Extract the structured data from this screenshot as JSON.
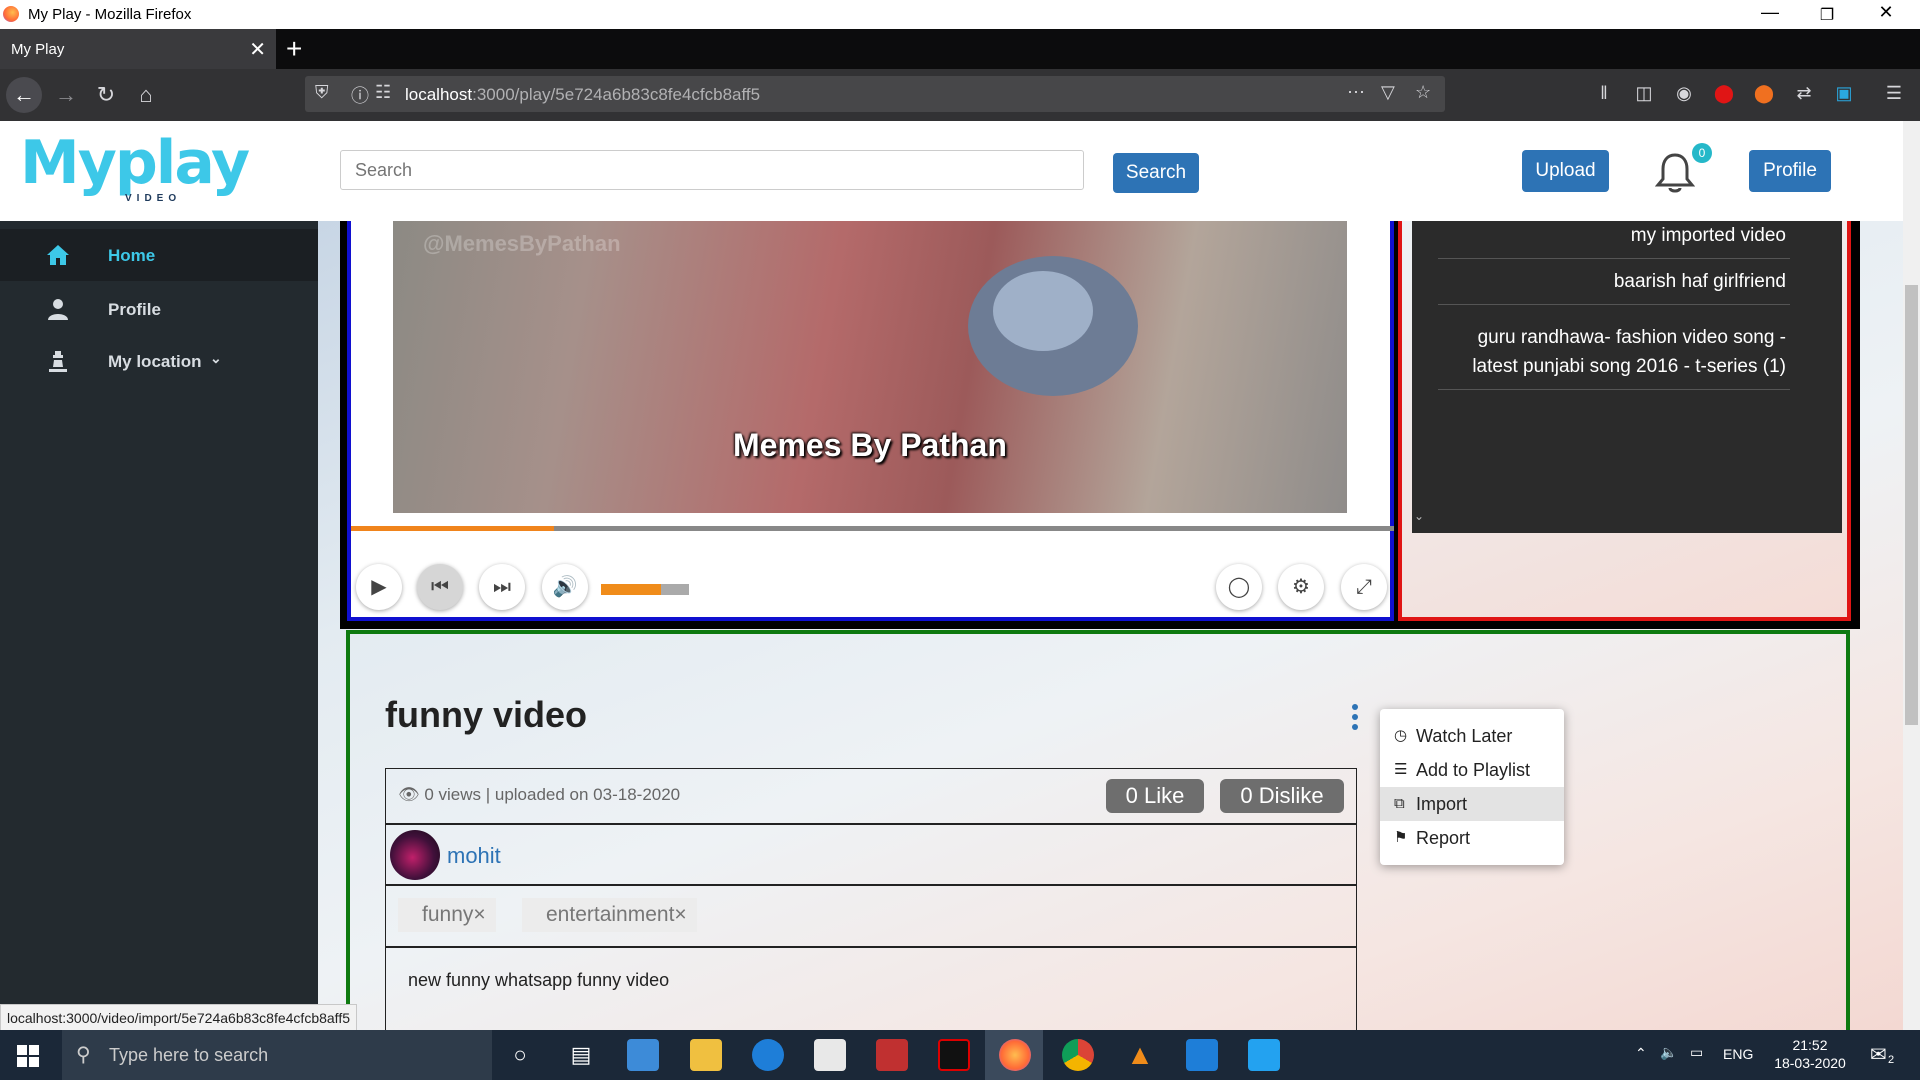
{
  "window": {
    "title": "My Play - Mozilla Firefox",
    "minimize": "—",
    "restore": "❐",
    "close": "✕"
  },
  "tab": {
    "title": "My Play",
    "close": "✕",
    "new": "+"
  },
  "url": {
    "host": "localhost",
    "rest": ":3000/play/5e724a6b83c8fe4cfcb8aff5"
  },
  "header": {
    "logo_main": "Myplay",
    "logo_sub": "VIDEO",
    "search_placeholder": "Search",
    "search_button": "Search",
    "upload_button": "Upload",
    "notification_count": "0",
    "profile_button": "Profile"
  },
  "sidebar": {
    "items": [
      {
        "label": "Home"
      },
      {
        "label": "Profile"
      },
      {
        "label": "My location"
      }
    ]
  },
  "player": {
    "watermark": "@MemesByPathan",
    "caption": "Memes By Pathan",
    "progress": 0.195,
    "volume": 0.68
  },
  "playlist": {
    "items": [
      {
        "title": "my imported video"
      },
      {
        "title": "baarish haf girlfriend"
      },
      {
        "title": "guru randhawa- fashion video song - latest punjabi song 2016 - t-series (1)"
      }
    ]
  },
  "video": {
    "title": "funny video",
    "meta": "0 views | uploaded on 03-18-2020",
    "like_label": "0 Like",
    "dislike_label": "0 Dislike",
    "uploader": "mohit",
    "tags": [
      {
        "label": "funny×"
      },
      {
        "label": "entertainment×"
      }
    ],
    "description": "new funny whatsapp funny video"
  },
  "menu": {
    "items": [
      {
        "label": "Watch Later",
        "icon": "clock-icon"
      },
      {
        "label": "Add to Playlist",
        "icon": "list-icon"
      },
      {
        "label": "Import",
        "icon": "copy-icon"
      },
      {
        "label": "Report",
        "icon": "flag-icon"
      }
    ]
  },
  "statusbar": {
    "url": "localhost:3000/video/import/5e724a6b83c8fe4cfcb8aff5"
  },
  "taskbar": {
    "search_placeholder": "Type here to search",
    "lang": "ENG",
    "time": "21:52",
    "date": "18-03-2020",
    "notif": "2"
  },
  "colors": {
    "accent": "#3dc8e8",
    "button": "#2d73b5",
    "sidebar": "#232a2f",
    "progress": "#f0841c"
  }
}
